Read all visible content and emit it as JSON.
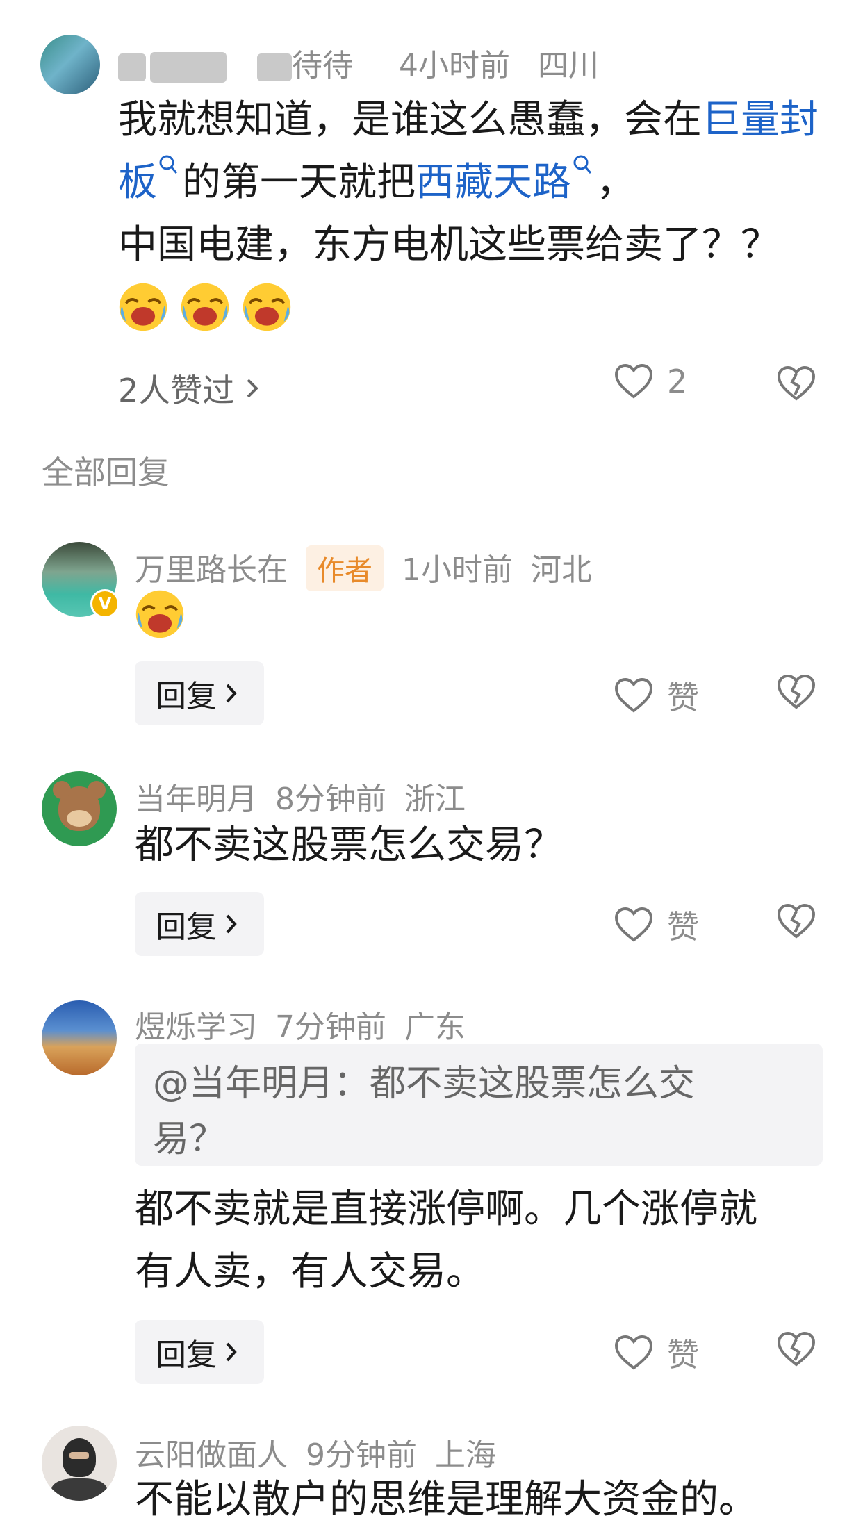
{
  "top_comment": {
    "username_visible": "待待",
    "time": "4小时前",
    "location": "四川",
    "text_parts": [
      "我就想知道，是谁这么愚蠢，会在",
      "巨量封板",
      "的第一天就把",
      "西藏天路",
      "，",
      "中国电建，东方电机这些票给卖了？？"
    ],
    "liked_by": "2人赞过",
    "like_count": "2"
  },
  "section_title": "全部回复",
  "replies": [
    {
      "username": "万里路长在",
      "badge": "作者",
      "time": "1小时前",
      "location": "河北",
      "reply_label": "回复",
      "like_label": "赞"
    },
    {
      "username": "当年明月",
      "time": "8分钟前",
      "location": "浙江",
      "text": "都不卖这股票怎么交易？",
      "reply_label": "回复",
      "like_label": "赞"
    },
    {
      "username": "煜烁学习",
      "time": "7分钟前",
      "location": "广东",
      "quote_line1": "@当年明月：都不卖这股票怎么交",
      "quote_line2": "易？",
      "text_line1": "都不卖就是直接涨停啊。几个涨停就",
      "text_line2": "有人卖，有人交易。",
      "reply_label": "回复",
      "like_label": "赞"
    },
    {
      "username": "云阳做面人",
      "time": "9分钟前",
      "location": "上海",
      "text": "不能以散户的思维是理解大资金的。"
    }
  ],
  "colors": {
    "link": "#1d63c8",
    "muted": "#8c8c8c",
    "author_tag_bg": "#fdf0e3",
    "author_tag_fg": "#e88a2a"
  }
}
